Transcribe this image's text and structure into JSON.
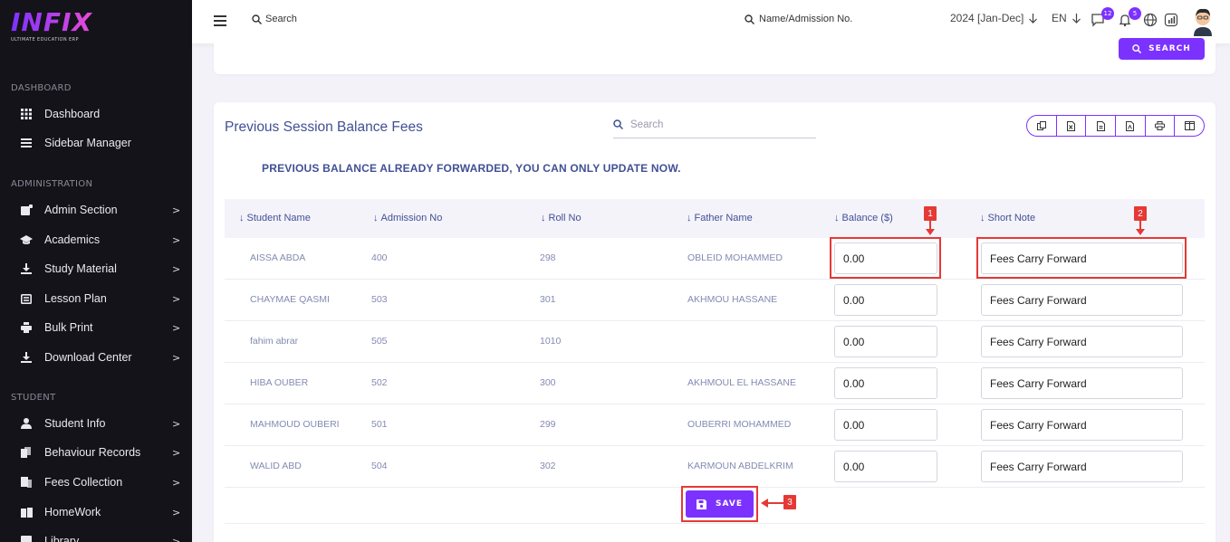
{
  "brand": {
    "logo_text": "INFIX",
    "logo_sub": "ULTIMATE EDUCATION ERP"
  },
  "sidebar": {
    "sections": [
      {
        "label": "DASHBOARD"
      },
      {
        "label": "ADMINISTRATION"
      },
      {
        "label": "STUDENT"
      }
    ],
    "items": [
      {
        "label": "Dashboard",
        "icon": "grid-icon"
      },
      {
        "label": "Sidebar Manager",
        "icon": "bars-icon"
      },
      {
        "label": "Admin Section",
        "icon": "admin-icon",
        "chevron": ">"
      },
      {
        "label": "Academics",
        "icon": "graduation-cap-icon",
        "chevron": ">"
      },
      {
        "label": "Study Material",
        "icon": "download-icon",
        "chevron": ">"
      },
      {
        "label": "Lesson Plan",
        "icon": "list-icon",
        "chevron": ">"
      },
      {
        "label": "Bulk Print",
        "icon": "print-icon",
        "chevron": ">"
      },
      {
        "label": "Download Center",
        "icon": "download-icon",
        "chevron": ">"
      },
      {
        "label": "Student Info",
        "icon": "user-icon",
        "chevron": ">"
      },
      {
        "label": "Behaviour Records",
        "icon": "copy-icon",
        "chevron": ">"
      },
      {
        "label": "Fees Collection",
        "icon": "fees-icon",
        "chevron": ">"
      },
      {
        "label": "HomeWork",
        "icon": "book-icon",
        "chevron": ">"
      },
      {
        "label": "Library",
        "icon": "library-icon",
        "chevron": ">"
      }
    ]
  },
  "header": {
    "search_label": "Search",
    "admission_search_label": "Name/Admission No.",
    "session": "2024 [Jan-Dec]",
    "language": "EN",
    "chat_badge": "12",
    "notification_badge": "5",
    "search_button": "SEARCH"
  },
  "card": {
    "title": "Previous Session Balance Fees",
    "search_placeholder": "Search",
    "notice": "PREVIOUS BALANCE ALREADY FORWARDED, YOU CAN ONLY UPDATE NOW.",
    "export_buttons": [
      "copy-icon",
      "excel-icon",
      "csv-icon",
      "pdf-icon",
      "print-icon",
      "columns-icon"
    ]
  },
  "table": {
    "headers": [
      "Student Name",
      "Admission No",
      "Roll No",
      "Father Name",
      "Balance ($)",
      "Short Note"
    ],
    "rows": [
      {
        "name": "AISSA ABDA",
        "admission": "400",
        "roll": "298",
        "father": "OBLEID MOHAMMED",
        "balance": "0.00",
        "note": "Fees Carry Forward"
      },
      {
        "name": "CHAYMAE QASMI",
        "admission": "503",
        "roll": "301",
        "father": "AKHMOU HASSANE",
        "balance": "0.00",
        "note": "Fees Carry Forward"
      },
      {
        "name": "fahim abrar",
        "admission": "505",
        "roll": "1010",
        "father": "",
        "balance": "0.00",
        "note": "Fees Carry Forward"
      },
      {
        "name": "HIBA OUBER",
        "admission": "502",
        "roll": "300",
        "father": "AKHMOUL EL HASSANE",
        "balance": "0.00",
        "note": "Fees Carry Forward"
      },
      {
        "name": "MAHMOUD OUBERI",
        "admission": "501",
        "roll": "299",
        "father": "OUBERRI MOHAMMED",
        "balance": "0.00",
        "note": "Fees Carry Forward"
      },
      {
        "name": "WALID ABD",
        "admission": "504",
        "roll": "302",
        "father": "KARMOUN ABDELKRIM",
        "balance": "0.00",
        "note": "Fees Carry Forward"
      }
    ],
    "save_button": "SAVE"
  },
  "annotations": [
    "1",
    "2",
    "3"
  ],
  "colors": {
    "accent": "#7c32ff",
    "sidebar_bg": "#14131a",
    "annotation": "#e53935",
    "text_primary": "#415094"
  }
}
